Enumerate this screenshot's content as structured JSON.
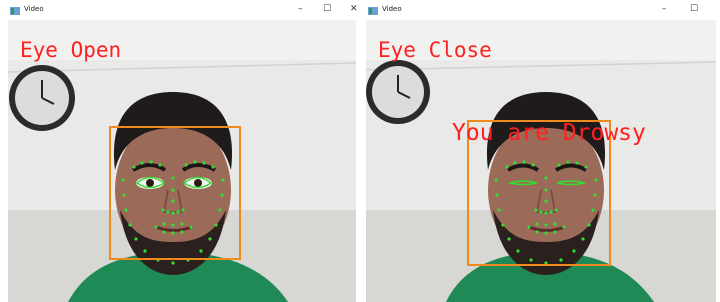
{
  "windows": [
    {
      "title": "Video",
      "controls": {
        "minimize": "–",
        "maximize": "☐",
        "close": "✕"
      },
      "overlay": {
        "status": "Eye Open"
      },
      "eyes": "open"
    },
    {
      "title": "Video",
      "controls": {
        "minimize": "–",
        "maximize": "☐"
      },
      "overlay": {
        "status": "Eye Close",
        "alert": "You are Drowsy"
      },
      "eyes": "closed"
    }
  ],
  "colors": {
    "overlay_text": "#ff2020",
    "face_box": "#f08a1c",
    "landmarks": "#33dd33",
    "shirt": "#1f8a55"
  }
}
